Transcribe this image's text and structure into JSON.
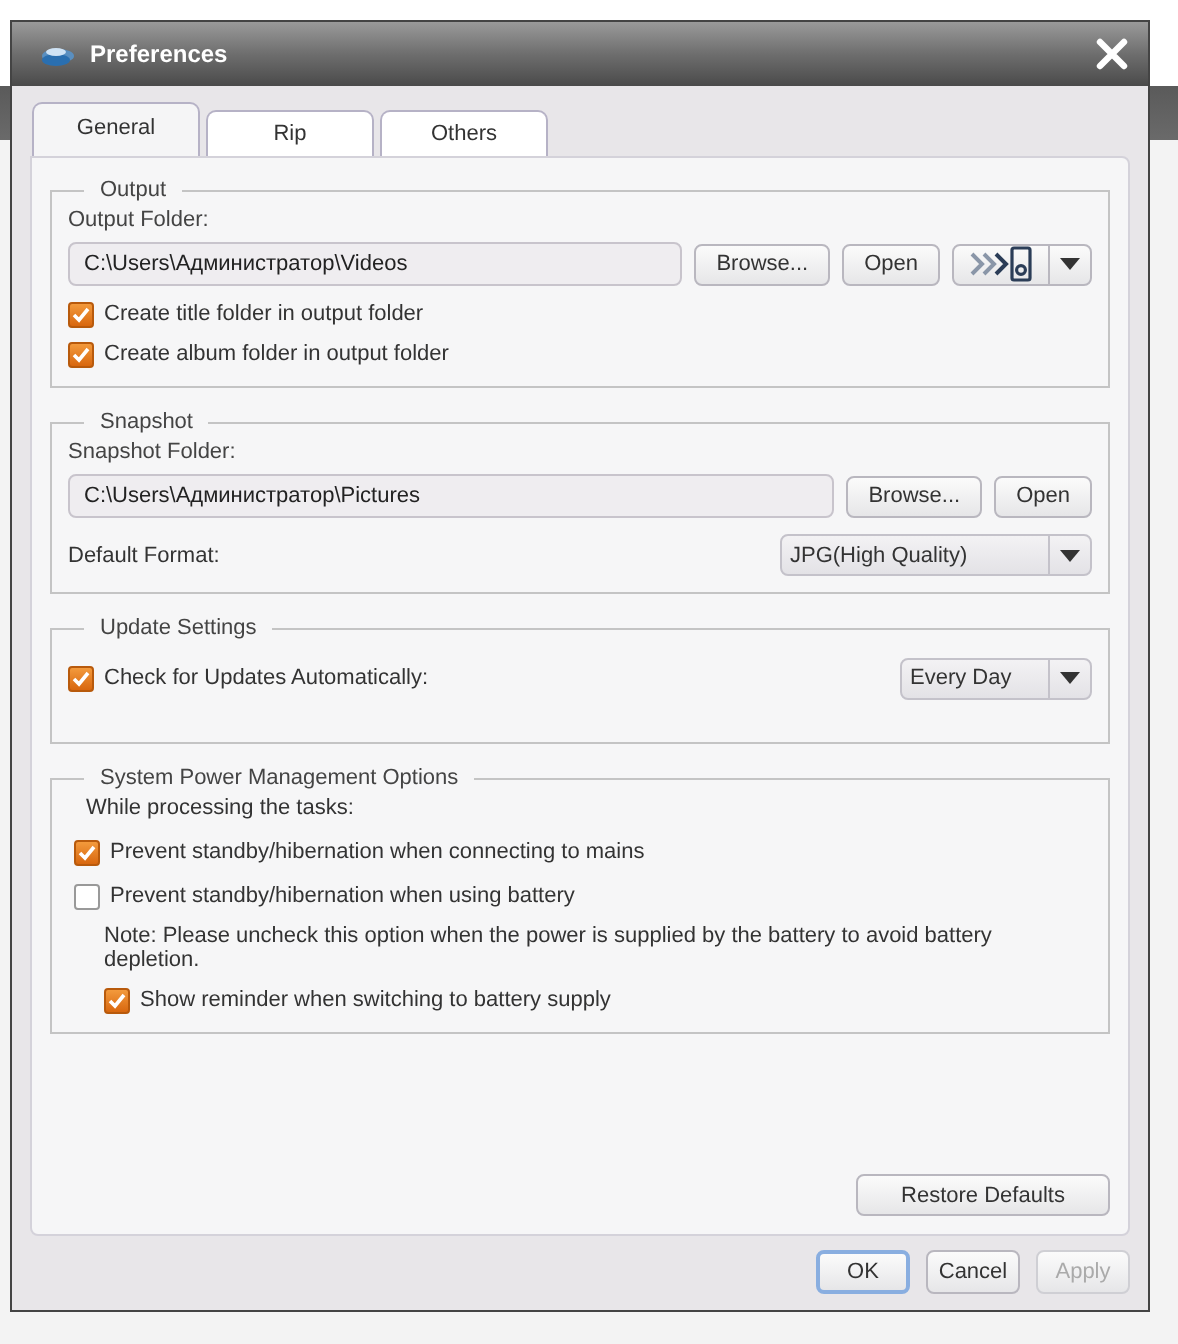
{
  "window": {
    "title": "Preferences"
  },
  "tabs": [
    {
      "label": "General",
      "selected": true
    },
    {
      "label": "Rip",
      "selected": false
    },
    {
      "label": "Others",
      "selected": false
    }
  ],
  "sections": [
    {
      "title": "Output",
      "rows": [
        {
          "kind": "label",
          "text": "Output Folder:"
        },
        {
          "kind": "folder",
          "value": "C:\\Users\\Администратор\\Videos",
          "buttons": [
            "Browse...",
            "Open"
          ],
          "device_menu": true
        },
        {
          "kind": "checkbox",
          "label": "Create title folder in output folder",
          "checked": true
        },
        {
          "kind": "checkbox",
          "label": "Create album folder in output folder",
          "checked": true
        }
      ]
    },
    {
      "title": "Snapshot",
      "rows": [
        {
          "kind": "label",
          "text": "Snapshot Folder:"
        },
        {
          "kind": "folder",
          "value": "C:\\Users\\Администратор\\Pictures",
          "buttons": [
            "Browse...",
            "Open"
          ]
        },
        {
          "kind": "select",
          "label": "Default Format:",
          "value": "JPG(High Quality)"
        }
      ]
    },
    {
      "title": "Update Settings",
      "rows": [
        {
          "kind": "checkbox",
          "label": "Check for Updates Automatically:",
          "checked": true,
          "value": "Every Day"
        }
      ]
    },
    {
      "title": "System Power Management Options",
      "rows": [
        {
          "kind": "text",
          "text": "While processing the tasks:"
        },
        {
          "kind": "checkbox",
          "label": "Prevent standby/hibernation when connecting to mains",
          "checked": true
        },
        {
          "kind": "checkbox",
          "label": "Prevent standby/hibernation when using battery",
          "checked": false,
          "children": [
            {
              "kind": "text",
              "text": "Note: Please uncheck this option when the power is supplied by the battery to avoid battery depletion."
            },
            {
              "kind": "checkbox",
              "label": "Show reminder when switching to battery supply",
              "checked": true
            }
          ]
        }
      ]
    }
  ],
  "restore_button": "Restore Defaults",
  "buttons": [
    {
      "label": "OK",
      "default": true,
      "disabled": false
    },
    {
      "label": "Cancel",
      "default": false,
      "disabled": false
    },
    {
      "label": "Apply",
      "default": false,
      "disabled": true
    }
  ]
}
